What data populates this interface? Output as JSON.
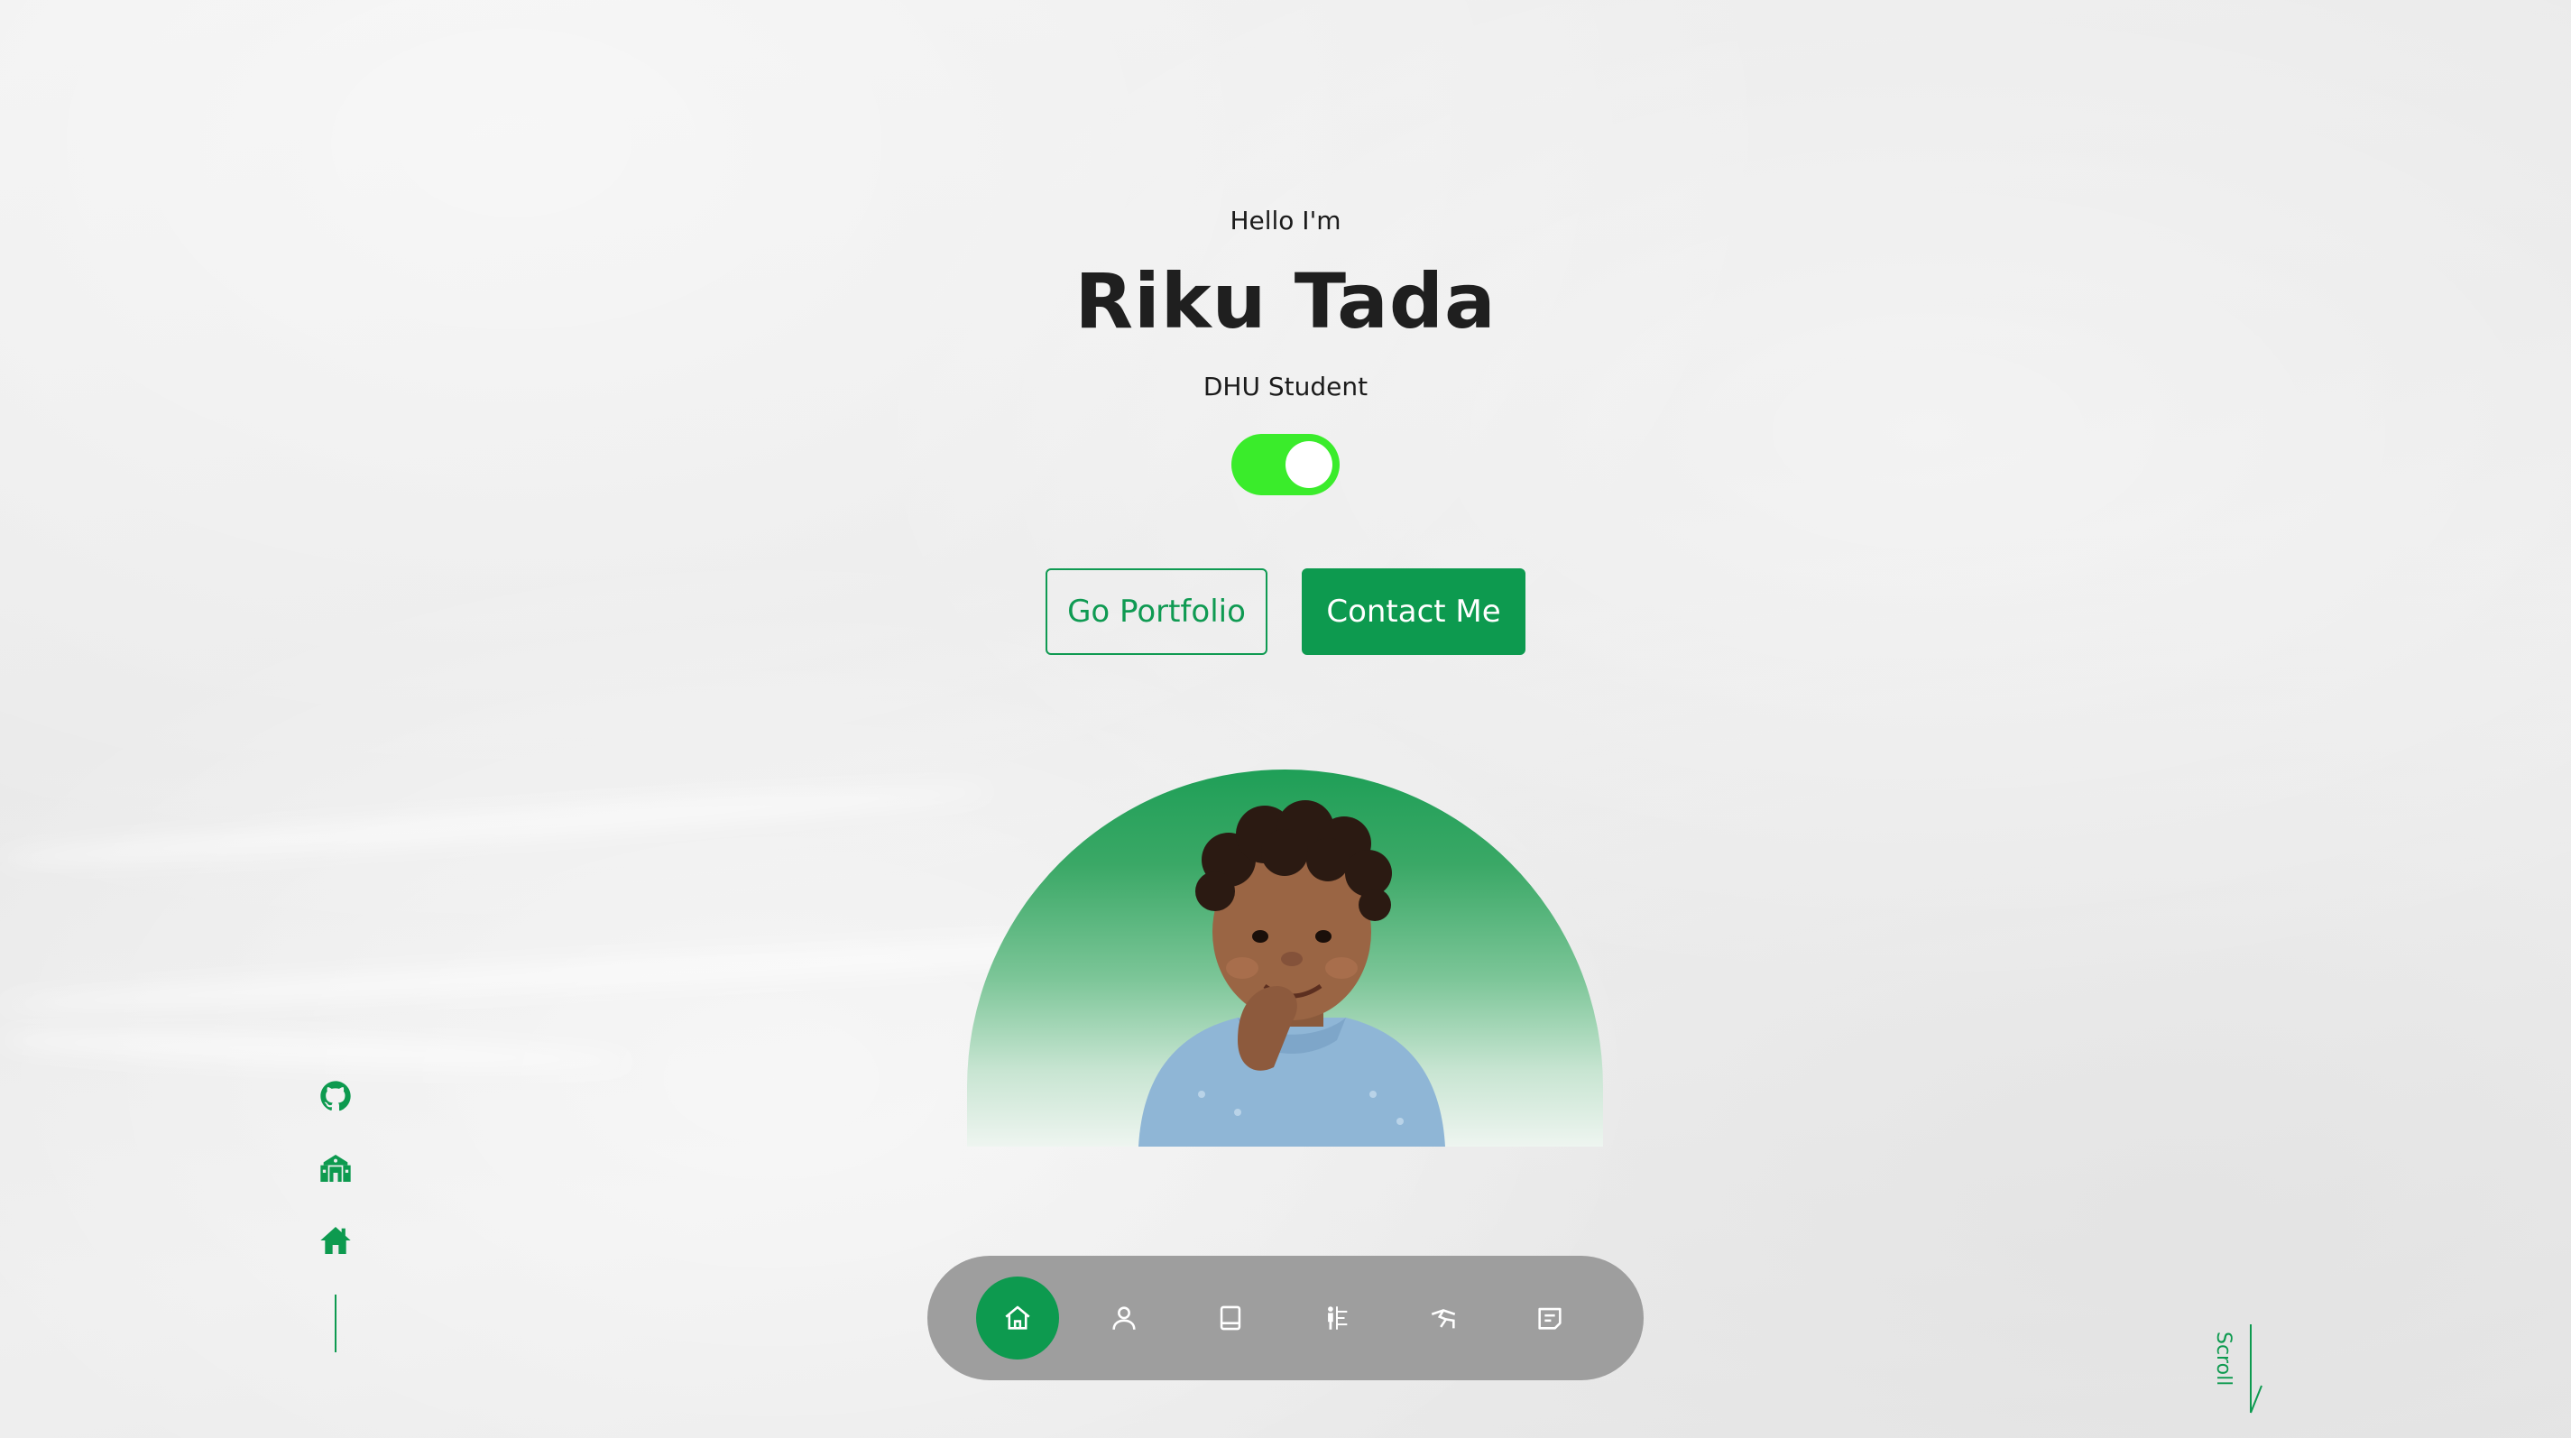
{
  "hero": {
    "greeting": "Hello I'm",
    "name": "Riku Tada",
    "role": "DHU Student"
  },
  "theme_toggle": {
    "state": "on",
    "color": "#3aec2b"
  },
  "buttons": {
    "portfolio_label": "Go Portfolio",
    "contact_label": "Contact Me"
  },
  "social_links": [
    {
      "icon": "github-icon"
    },
    {
      "icon": "school-icon"
    },
    {
      "icon": "house-icon"
    }
  ],
  "nav": {
    "items": [
      {
        "icon": "home-icon",
        "active": true
      },
      {
        "icon": "user-icon",
        "active": false
      },
      {
        "icon": "book-icon",
        "active": false
      },
      {
        "icon": "experience-icon",
        "active": false
      },
      {
        "icon": "portfolio-icon",
        "active": false
      },
      {
        "icon": "message-icon",
        "active": false
      }
    ]
  },
  "scroll": {
    "label": "Scroll"
  },
  "colors": {
    "accent": "#0d9a4f",
    "toggle": "#3aec2b",
    "nav_bg": "#9e9e9e",
    "text": "#1b1b1b"
  }
}
